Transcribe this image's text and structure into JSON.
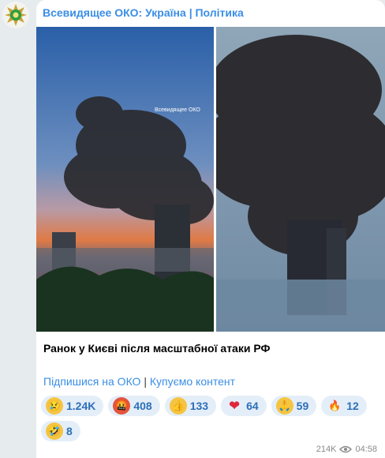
{
  "channel": {
    "title": "Всевидящее ОКО: Україна | Політика"
  },
  "photos": {
    "watermark": "Всевидящее ОКО"
  },
  "post": {
    "caption": "Ранок у Києві після масштабної атаки РФ",
    "links": {
      "subscribe": "Підпишися на ОКО",
      "separator": "|",
      "buy_content": "Купуємо контент"
    }
  },
  "reactions": [
    {
      "emoji": "crying-face",
      "glyph": "😢",
      "bg": "#f5c542",
      "count": "1.24K"
    },
    {
      "emoji": "angry-face",
      "glyph": "🤬",
      "bg": "#e2553c",
      "count": "408"
    },
    {
      "emoji": "thumbs-up",
      "glyph": "👍",
      "bg": "#f5c542",
      "count": "133"
    },
    {
      "emoji": "red-heart",
      "glyph": "❤",
      "bg": "transparent",
      "count": "64"
    },
    {
      "emoji": "folded-hands",
      "glyph": "🙏",
      "bg": "#f5c542",
      "count": "59"
    },
    {
      "emoji": "fire",
      "glyph": "🔥",
      "bg": "transparent",
      "count": "12"
    },
    {
      "emoji": "rofl-face",
      "glyph": "🤣",
      "bg": "#f5c542",
      "count": "8"
    }
  ],
  "meta": {
    "views": "214K",
    "time": "04:58"
  },
  "colors": {
    "accent": "#3a8ee6",
    "reaction_bg": "#e4eef8",
    "reaction_text": "#2c6fb8"
  }
}
